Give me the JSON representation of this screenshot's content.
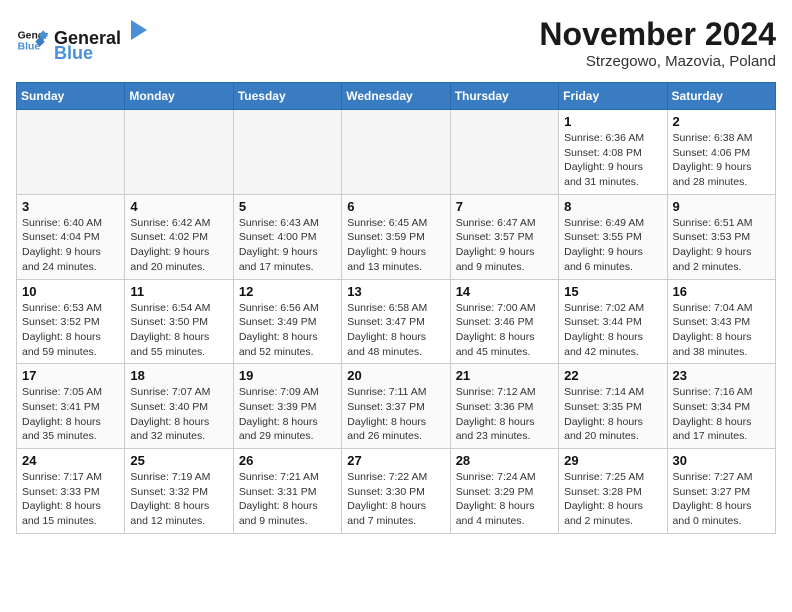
{
  "header": {
    "logo_line1": "General",
    "logo_line2": "Blue",
    "month_title": "November 2024",
    "location": "Strzegowo, Mazovia, Poland"
  },
  "calendar": {
    "weekdays": [
      "Sunday",
      "Monday",
      "Tuesday",
      "Wednesday",
      "Thursday",
      "Friday",
      "Saturday"
    ],
    "weeks": [
      [
        {
          "day": "",
          "info": ""
        },
        {
          "day": "",
          "info": ""
        },
        {
          "day": "",
          "info": ""
        },
        {
          "day": "",
          "info": ""
        },
        {
          "day": "",
          "info": ""
        },
        {
          "day": "1",
          "info": "Sunrise: 6:36 AM\nSunset: 4:08 PM\nDaylight: 9 hours and 31 minutes."
        },
        {
          "day": "2",
          "info": "Sunrise: 6:38 AM\nSunset: 4:06 PM\nDaylight: 9 hours and 28 minutes."
        }
      ],
      [
        {
          "day": "3",
          "info": "Sunrise: 6:40 AM\nSunset: 4:04 PM\nDaylight: 9 hours and 24 minutes."
        },
        {
          "day": "4",
          "info": "Sunrise: 6:42 AM\nSunset: 4:02 PM\nDaylight: 9 hours and 20 minutes."
        },
        {
          "day": "5",
          "info": "Sunrise: 6:43 AM\nSunset: 4:00 PM\nDaylight: 9 hours and 17 minutes."
        },
        {
          "day": "6",
          "info": "Sunrise: 6:45 AM\nSunset: 3:59 PM\nDaylight: 9 hours and 13 minutes."
        },
        {
          "day": "7",
          "info": "Sunrise: 6:47 AM\nSunset: 3:57 PM\nDaylight: 9 hours and 9 minutes."
        },
        {
          "day": "8",
          "info": "Sunrise: 6:49 AM\nSunset: 3:55 PM\nDaylight: 9 hours and 6 minutes."
        },
        {
          "day": "9",
          "info": "Sunrise: 6:51 AM\nSunset: 3:53 PM\nDaylight: 9 hours and 2 minutes."
        }
      ],
      [
        {
          "day": "10",
          "info": "Sunrise: 6:53 AM\nSunset: 3:52 PM\nDaylight: 8 hours and 59 minutes."
        },
        {
          "day": "11",
          "info": "Sunrise: 6:54 AM\nSunset: 3:50 PM\nDaylight: 8 hours and 55 minutes."
        },
        {
          "day": "12",
          "info": "Sunrise: 6:56 AM\nSunset: 3:49 PM\nDaylight: 8 hours and 52 minutes."
        },
        {
          "day": "13",
          "info": "Sunrise: 6:58 AM\nSunset: 3:47 PM\nDaylight: 8 hours and 48 minutes."
        },
        {
          "day": "14",
          "info": "Sunrise: 7:00 AM\nSunset: 3:46 PM\nDaylight: 8 hours and 45 minutes."
        },
        {
          "day": "15",
          "info": "Sunrise: 7:02 AM\nSunset: 3:44 PM\nDaylight: 8 hours and 42 minutes."
        },
        {
          "day": "16",
          "info": "Sunrise: 7:04 AM\nSunset: 3:43 PM\nDaylight: 8 hours and 38 minutes."
        }
      ],
      [
        {
          "day": "17",
          "info": "Sunrise: 7:05 AM\nSunset: 3:41 PM\nDaylight: 8 hours and 35 minutes."
        },
        {
          "day": "18",
          "info": "Sunrise: 7:07 AM\nSunset: 3:40 PM\nDaylight: 8 hours and 32 minutes."
        },
        {
          "day": "19",
          "info": "Sunrise: 7:09 AM\nSunset: 3:39 PM\nDaylight: 8 hours and 29 minutes."
        },
        {
          "day": "20",
          "info": "Sunrise: 7:11 AM\nSunset: 3:37 PM\nDaylight: 8 hours and 26 minutes."
        },
        {
          "day": "21",
          "info": "Sunrise: 7:12 AM\nSunset: 3:36 PM\nDaylight: 8 hours and 23 minutes."
        },
        {
          "day": "22",
          "info": "Sunrise: 7:14 AM\nSunset: 3:35 PM\nDaylight: 8 hours and 20 minutes."
        },
        {
          "day": "23",
          "info": "Sunrise: 7:16 AM\nSunset: 3:34 PM\nDaylight: 8 hours and 17 minutes."
        }
      ],
      [
        {
          "day": "24",
          "info": "Sunrise: 7:17 AM\nSunset: 3:33 PM\nDaylight: 8 hours and 15 minutes."
        },
        {
          "day": "25",
          "info": "Sunrise: 7:19 AM\nSunset: 3:32 PM\nDaylight: 8 hours and 12 minutes."
        },
        {
          "day": "26",
          "info": "Sunrise: 7:21 AM\nSunset: 3:31 PM\nDaylight: 8 hours and 9 minutes."
        },
        {
          "day": "27",
          "info": "Sunrise: 7:22 AM\nSunset: 3:30 PM\nDaylight: 8 hours and 7 minutes."
        },
        {
          "day": "28",
          "info": "Sunrise: 7:24 AM\nSunset: 3:29 PM\nDaylight: 8 hours and 4 minutes."
        },
        {
          "day": "29",
          "info": "Sunrise: 7:25 AM\nSunset: 3:28 PM\nDaylight: 8 hours and 2 minutes."
        },
        {
          "day": "30",
          "info": "Sunrise: 7:27 AM\nSunset: 3:27 PM\nDaylight: 8 hours and 0 minutes."
        }
      ]
    ]
  }
}
